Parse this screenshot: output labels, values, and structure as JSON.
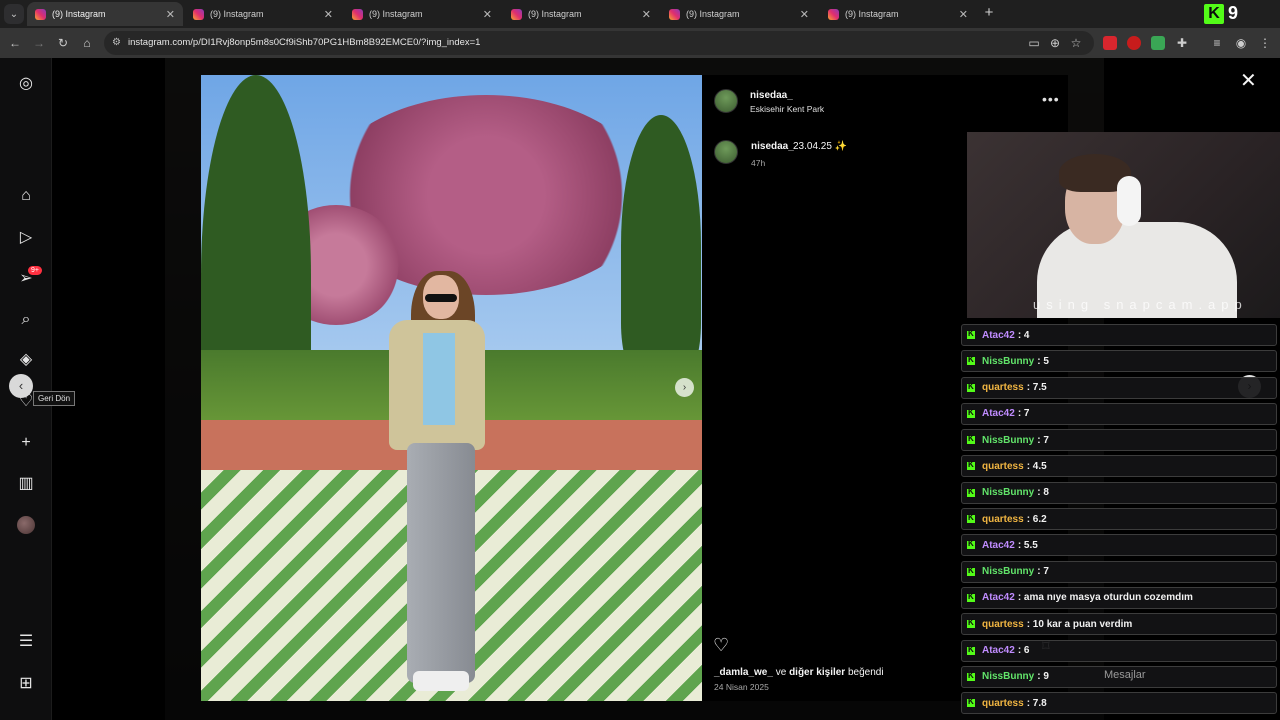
{
  "browser": {
    "tabs": [
      {
        "label": "(9) Instagram"
      },
      {
        "label": "(9) Instagram"
      },
      {
        "label": "(9) Instagram"
      },
      {
        "label": "(9) Instagram"
      },
      {
        "label": "(9) Instagram"
      },
      {
        "label": "(9) Instagram"
      }
    ],
    "url": "instagram.com/p/DI1Rvj8onp5m8s0Cf9iShb70PG1HBm8B92EMCE0/?img_index=1",
    "kick_count": "9",
    "kick_logo": "K"
  },
  "sidebar": {
    "notification_badge": "9+",
    "icons": [
      "instagram-icon",
      "home-icon",
      "reels-icon",
      "messages-icon",
      "search-icon",
      "explore-icon",
      "notifications-icon",
      "create-icon",
      "dashboard-icon",
      "profile-avatar",
      "menu-icon",
      "more-apps-icon"
    ]
  },
  "tooltip": {
    "text": "Geri Dön"
  },
  "post": {
    "username": "nisedaa_",
    "location": "Eskisehir Kent Park",
    "caption_user": "nisedaa_",
    "caption_text": "23.04.25 ✨",
    "caption_time": "47h",
    "likes_user": "_damla_we_",
    "likes_mid": "ve",
    "likes_others": "diğer kişiler",
    "likes_end": "beğendi",
    "date": "24 Nisan 2025"
  },
  "chat": [
    {
      "user": "Atac42",
      "msg": "4",
      "color": "#c08cff"
    },
    {
      "user": "NissBunny",
      "msg": "5",
      "color": "#62e46a"
    },
    {
      "user": "quartess",
      "msg": "7.5",
      "color": "#f0b542"
    },
    {
      "user": "Atac42",
      "msg": "7",
      "color": "#c08cff"
    },
    {
      "user": "NissBunny",
      "msg": "7",
      "color": "#62e46a"
    },
    {
      "user": "quartess",
      "msg": "4.5",
      "color": "#f0b542"
    },
    {
      "user": "NissBunny",
      "msg": "8",
      "color": "#62e46a"
    },
    {
      "user": "quartess",
      "msg": "6.2",
      "color": "#f0b542"
    },
    {
      "user": "Atac42",
      "msg": "5.5",
      "color": "#c08cff"
    },
    {
      "user": "NissBunny",
      "msg": "7",
      "color": "#62e46a"
    },
    {
      "user": "Atac42",
      "msg": "ama nıye masya oturdun cozemdım",
      "color": "#c08cff"
    },
    {
      "user": "quartess",
      "msg": "10 kar a puan verdim",
      "color": "#f0b542"
    },
    {
      "user": "Atac42",
      "msg": "6",
      "color": "#c08cff"
    },
    {
      "user": "NissBunny",
      "msg": "9",
      "color": "#62e46a"
    },
    {
      "user": "quartess",
      "msg": "7.8",
      "color": "#f0b542"
    }
  ],
  "cam_watermark": "using snapcam.app",
  "messages_label": "Mesajlar",
  "colors": {
    "kick_green": "#53fc18",
    "ig_red": "#ff3040"
  }
}
